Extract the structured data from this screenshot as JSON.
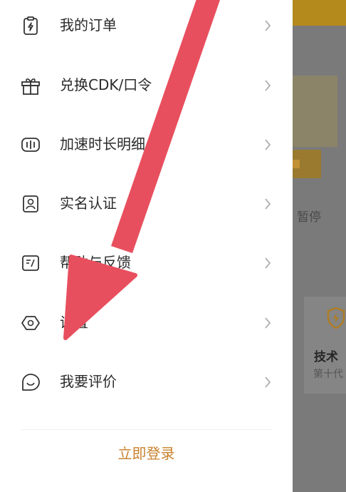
{
  "background_app": {
    "pause_label": "暂停",
    "tech_label": "技术",
    "generation_label": "第十代"
  },
  "menu": {
    "items": [
      {
        "label": "我的订单",
        "icon": "order-clipboard-icon"
      },
      {
        "label": "兑换CDK/口令",
        "icon": "gift-icon"
      },
      {
        "label": "加速时长明细",
        "icon": "timer-bars-icon"
      },
      {
        "label": "实名认证",
        "icon": "id-person-icon"
      },
      {
        "label": "帮助与反馈",
        "icon": "feedback-icon"
      },
      {
        "label": "设置",
        "icon": "settings-hexagon-icon"
      },
      {
        "label": "我要评价",
        "icon": "rate-smile-icon"
      }
    ]
  },
  "login_label": "立即登录",
  "colors": {
    "accent": "#c9822e",
    "annotation_arrow": "#e84f5e",
    "overlay": "#7a7a7a"
  }
}
